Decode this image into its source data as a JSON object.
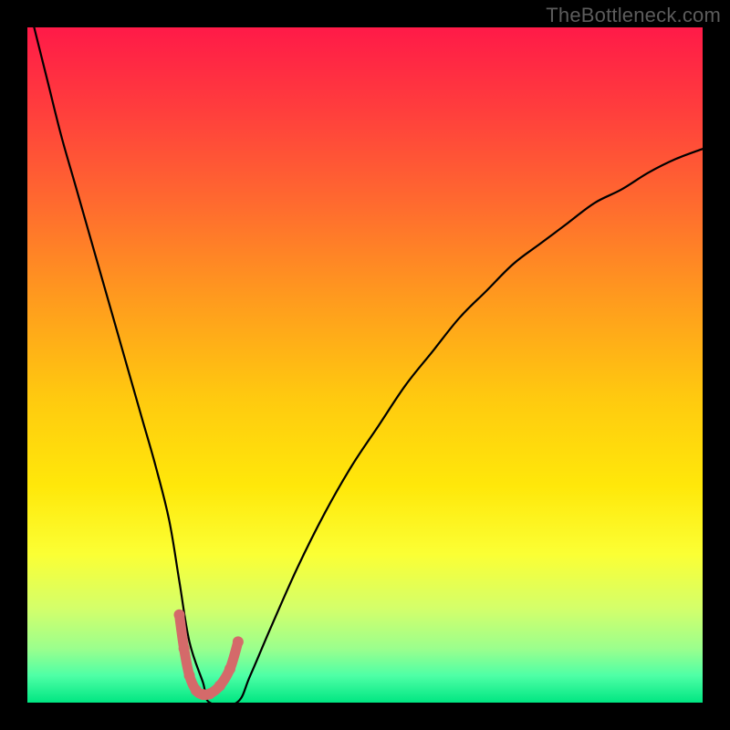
{
  "watermark": "TheBottleneck.com",
  "chart_data": {
    "type": "line",
    "title": "",
    "xlabel": "",
    "ylabel": "",
    "xlim": [
      0,
      100
    ],
    "ylim": [
      0,
      100
    ],
    "grid": false,
    "legend": false,
    "background_gradient_stops": [
      {
        "offset": 0.0,
        "color": "#ff1a48"
      },
      {
        "offset": 0.12,
        "color": "#ff3d3d"
      },
      {
        "offset": 0.26,
        "color": "#ff6a2f"
      },
      {
        "offset": 0.4,
        "color": "#ff9a1e"
      },
      {
        "offset": 0.55,
        "color": "#ffca0f"
      },
      {
        "offset": 0.68,
        "color": "#ffe80a"
      },
      {
        "offset": 0.78,
        "color": "#fbff34"
      },
      {
        "offset": 0.86,
        "color": "#d4ff6a"
      },
      {
        "offset": 0.92,
        "color": "#9bff8d"
      },
      {
        "offset": 0.96,
        "color": "#4effa6"
      },
      {
        "offset": 1.0,
        "color": "#00e682"
      }
    ],
    "series": [
      {
        "name": "bottleneck-curve",
        "color": "#000000",
        "stroke_width": 2.2,
        "x": [
          1,
          3,
          5,
          7,
          9,
          11,
          13,
          15,
          17,
          19,
          21,
          22.5,
          24,
          26,
          27,
          31,
          33,
          36,
          40,
          44,
          48,
          52,
          56,
          60,
          64,
          68,
          72,
          76,
          80,
          84,
          88,
          92,
          96,
          100
        ],
        "y": [
          100,
          92,
          84,
          77,
          70,
          63,
          56,
          49,
          42,
          35,
          27,
          18,
          9,
          3,
          0,
          0,
          4,
          11,
          20,
          28,
          35,
          41,
          47,
          52,
          57,
          61,
          65,
          68,
          71,
          74,
          76,
          78.5,
          80.5,
          82
        ]
      },
      {
        "name": "highlight-valley",
        "color": "#d46a6a",
        "stroke_width": 11,
        "linecap": "round",
        "x": [
          22.5,
          23.2,
          24.0,
          25.0,
          26.0,
          27.0,
          28.5,
          30.0,
          31.2
        ],
        "y": [
          13.0,
          8.0,
          4.0,
          1.8,
          1.2,
          1.3,
          2.5,
          5.0,
          9.0
        ]
      }
    ]
  }
}
